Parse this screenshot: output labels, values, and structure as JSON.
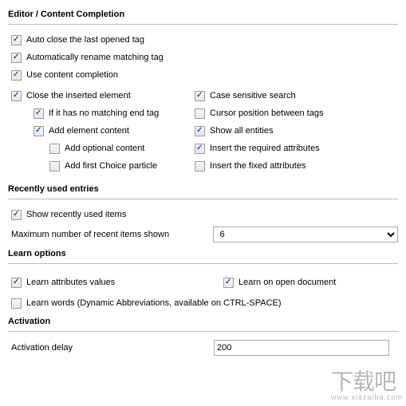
{
  "title": "Editor / Content Completion",
  "main": {
    "auto_close": {
      "label": "Auto close the last opened tag",
      "checked": true
    },
    "auto_rename": {
      "label": "Automatically rename matching tag",
      "checked": true
    },
    "use_cc": {
      "label": "Use content completion",
      "checked": true
    },
    "close_inserted": {
      "label": "Close the inserted element",
      "checked": true
    },
    "no_match_end": {
      "label": "If it has no matching end tag",
      "checked": true
    },
    "add_element": {
      "label": "Add element content",
      "checked": true
    },
    "add_optional": {
      "label": "Add optional content",
      "checked": false
    },
    "add_first_choice": {
      "label": "Add first Choice particle",
      "checked": false
    },
    "case_sensitive": {
      "label": "Case sensitive search",
      "checked": true
    },
    "cursor_between": {
      "label": "Cursor position between tags",
      "checked": false
    },
    "show_entities": {
      "label": "Show all entities",
      "checked": true
    },
    "insert_required": {
      "label": "Insert the required attributes",
      "checked": true
    },
    "insert_fixed": {
      "label": "Insert the fixed attributes",
      "checked": false
    }
  },
  "recent": {
    "title": "Recently used entries",
    "show": {
      "label": "Show recently used items",
      "checked": true
    },
    "max_label": "Maximum number of recent items shown",
    "max_value": "6"
  },
  "learn": {
    "title": "Learn options",
    "attr_values": {
      "label": "Learn attributes values",
      "checked": true
    },
    "on_open": {
      "label": "Learn on open document",
      "checked": true
    },
    "words": {
      "label": "Learn words (Dynamic Abbreviations, available on CTRL-SPACE)",
      "checked": false
    }
  },
  "activation": {
    "title": "Activation",
    "delay_label": "Activation delay",
    "delay_value": "200"
  },
  "watermark": {
    "main": "下载吧",
    "sub": "www.xiazaiba.com"
  }
}
